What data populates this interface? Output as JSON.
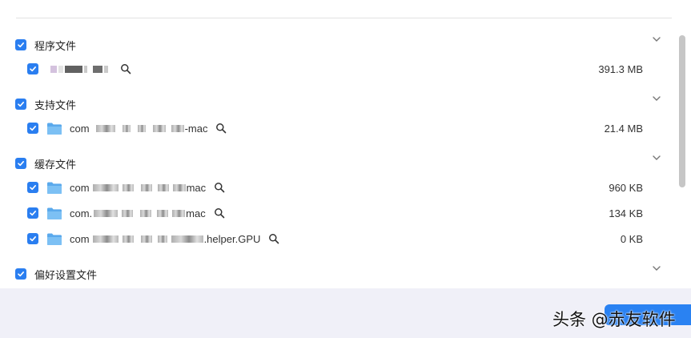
{
  "groups": [
    {
      "label": "程序文件",
      "checked": true,
      "items": [
        {
          "name_prefix": "",
          "name_suffix": "",
          "size": "391.3 MB",
          "checked": true
        }
      ]
    },
    {
      "label": "支持文件",
      "checked": true,
      "items": [
        {
          "name_prefix": "com",
          "name_suffix": "-mac",
          "size": "21.4 MB",
          "checked": true
        }
      ]
    },
    {
      "label": "缓存文件",
      "checked": true,
      "items": [
        {
          "name_prefix": "com",
          "name_suffix": "mac",
          "size": "960 KB",
          "checked": true
        },
        {
          "name_prefix": "com.",
          "name_suffix": "mac",
          "size": "134 KB",
          "checked": true
        },
        {
          "name_prefix": "com",
          "name_suffix": ".helper.GPU",
          "size": "0 KB",
          "checked": true
        }
      ]
    },
    {
      "label": "偏好设置文件",
      "checked": true,
      "items": []
    }
  ],
  "icons": {
    "checkbox": "checkmark-icon",
    "folder": "folder-icon",
    "reveal": "magnifier-icon",
    "expand": "chevron-down-icon"
  },
  "colors": {
    "accent": "#2a7ef0",
    "folder": "#6fb6f0",
    "footer_bg": "#f0f0f8"
  },
  "watermark": "头条 @赤友软件"
}
